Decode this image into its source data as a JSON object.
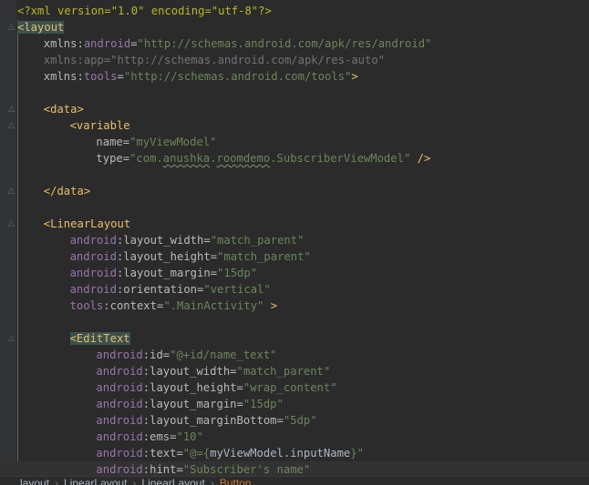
{
  "editor": {
    "language": "xml",
    "lines": [
      {
        "indent": 0,
        "fold": false,
        "current": false,
        "tokens": [
          {
            "t": "<?xml version=\"1.0\" encoding=\"utf-8\"?>",
            "c": "def"
          }
        ]
      },
      {
        "indent": 0,
        "fold": true,
        "current": false,
        "tokens": [
          {
            "t": "<",
            "c": "tag-hl"
          },
          {
            "t": "layout",
            "c": "tag-hl"
          }
        ]
      },
      {
        "indent": 4,
        "fold": false,
        "current": false,
        "tokens": [
          {
            "t": "xmlns",
            "c": "attr"
          },
          {
            "t": ":",
            "c": "attr"
          },
          {
            "t": "android",
            "c": "pre"
          },
          {
            "t": "=",
            "c": "attr"
          },
          {
            "t": "\"http://schemas.android.com/apk/res/android\"",
            "c": "str"
          }
        ]
      },
      {
        "indent": 4,
        "fold": false,
        "current": false,
        "tokens": [
          {
            "t": "xmlns:app=",
            "c": "ns-unused"
          },
          {
            "t": "\"http://schemas.android.com/apk/res-auto\"",
            "c": "ns-unused"
          }
        ]
      },
      {
        "indent": 4,
        "fold": false,
        "current": false,
        "tokens": [
          {
            "t": "xmlns",
            "c": "attr"
          },
          {
            "t": ":",
            "c": "attr"
          },
          {
            "t": "tools",
            "c": "pre"
          },
          {
            "t": "=",
            "c": "attr"
          },
          {
            "t": "\"http://schemas.android.com/tools\"",
            "c": "str"
          },
          {
            "t": ">",
            "c": "tag"
          }
        ]
      },
      {
        "indent": 0,
        "fold": false,
        "current": false,
        "tokens": []
      },
      {
        "indent": 4,
        "fold": true,
        "current": false,
        "tokens": [
          {
            "t": "<data>",
            "c": "tag"
          }
        ]
      },
      {
        "indent": 8,
        "fold": true,
        "current": false,
        "tokens": [
          {
            "t": "<variable",
            "c": "tag"
          }
        ]
      },
      {
        "indent": 12,
        "fold": false,
        "current": false,
        "tokens": [
          {
            "t": "name=",
            "c": "attr"
          },
          {
            "t": "\"myViewModel\"",
            "c": "str"
          }
        ]
      },
      {
        "indent": 12,
        "fold": false,
        "current": false,
        "tokens": [
          {
            "t": "type=",
            "c": "attr"
          },
          {
            "t": "\"com.",
            "c": "str"
          },
          {
            "t": "anushka",
            "c": "str-squig"
          },
          {
            "t": ".",
            "c": "str"
          },
          {
            "t": "roomdemo",
            "c": "str-squig"
          },
          {
            "t": ".SubscriberViewModel\"",
            "c": "str"
          },
          {
            "t": " ",
            "c": "sp"
          },
          {
            "t": "/>",
            "c": "tag"
          }
        ]
      },
      {
        "indent": 0,
        "fold": false,
        "current": false,
        "tokens": []
      },
      {
        "indent": 4,
        "fold": true,
        "current": false,
        "tokens": [
          {
            "t": "</data>",
            "c": "tag"
          }
        ]
      },
      {
        "indent": 0,
        "fold": false,
        "current": false,
        "tokens": []
      },
      {
        "indent": 4,
        "fold": true,
        "current": false,
        "tokens": [
          {
            "t": "<LinearLayout",
            "c": "tag"
          }
        ]
      },
      {
        "indent": 8,
        "fold": false,
        "current": false,
        "tokens": [
          {
            "t": "android",
            "c": "pre"
          },
          {
            "t": ":layout_width=",
            "c": "attr"
          },
          {
            "t": "\"match_parent\"",
            "c": "str"
          }
        ]
      },
      {
        "indent": 8,
        "fold": false,
        "current": false,
        "tokens": [
          {
            "t": "android",
            "c": "pre"
          },
          {
            "t": ":layout_height=",
            "c": "attr"
          },
          {
            "t": "\"match_parent\"",
            "c": "str"
          }
        ]
      },
      {
        "indent": 8,
        "fold": false,
        "current": false,
        "tokens": [
          {
            "t": "android",
            "c": "pre"
          },
          {
            "t": ":layout_margin=",
            "c": "attr"
          },
          {
            "t": "\"15dp\"",
            "c": "str"
          }
        ]
      },
      {
        "indent": 8,
        "fold": false,
        "current": false,
        "tokens": [
          {
            "t": "android",
            "c": "pre"
          },
          {
            "t": ":orientation=",
            "c": "attr"
          },
          {
            "t": "\"vertical\"",
            "c": "str"
          }
        ]
      },
      {
        "indent": 8,
        "fold": false,
        "current": false,
        "tokens": [
          {
            "t": "tools",
            "c": "pre"
          },
          {
            "t": ":context=",
            "c": "attr"
          },
          {
            "t": "\".MainActivity\"",
            "c": "str"
          },
          {
            "t": " ",
            "c": "sp"
          },
          {
            "t": ">",
            "c": "tag"
          }
        ]
      },
      {
        "indent": 0,
        "fold": false,
        "current": false,
        "tokens": []
      },
      {
        "indent": 8,
        "fold": true,
        "current": false,
        "tokens": [
          {
            "t": "<EditText",
            "c": "tag-hl"
          }
        ]
      },
      {
        "indent": 12,
        "fold": false,
        "current": false,
        "tokens": [
          {
            "t": "android",
            "c": "pre"
          },
          {
            "t": ":id=",
            "c": "attr"
          },
          {
            "t": "\"@+id/name_text\"",
            "c": "str"
          }
        ]
      },
      {
        "indent": 12,
        "fold": false,
        "current": false,
        "tokens": [
          {
            "t": "android",
            "c": "pre"
          },
          {
            "t": ":layout_width=",
            "c": "attr"
          },
          {
            "t": "\"match_parent\"",
            "c": "str"
          }
        ]
      },
      {
        "indent": 12,
        "fold": false,
        "current": false,
        "tokens": [
          {
            "t": "android",
            "c": "pre"
          },
          {
            "t": ":layout_height=",
            "c": "attr"
          },
          {
            "t": "\"wrap_content\"",
            "c": "str"
          }
        ]
      },
      {
        "indent": 12,
        "fold": false,
        "current": false,
        "tokens": [
          {
            "t": "android",
            "c": "pre"
          },
          {
            "t": ":layout_margin=",
            "c": "attr"
          },
          {
            "t": "\"15dp\"",
            "c": "str"
          }
        ]
      },
      {
        "indent": 12,
        "fold": false,
        "current": false,
        "tokens": [
          {
            "t": "android",
            "c": "pre"
          },
          {
            "t": ":layout_marginBottom=",
            "c": "attr"
          },
          {
            "t": "\"5dp\"",
            "c": "str"
          }
        ]
      },
      {
        "indent": 12,
        "fold": false,
        "current": false,
        "tokens": [
          {
            "t": "android",
            "c": "pre"
          },
          {
            "t": ":ems=",
            "c": "attr"
          },
          {
            "t": "\"10\"",
            "c": "str"
          }
        ]
      },
      {
        "indent": 12,
        "fold": false,
        "current": false,
        "tokens": [
          {
            "t": "android",
            "c": "pre"
          },
          {
            "t": ":text=",
            "c": "attr"
          },
          {
            "t": "\"@={",
            "c": "str"
          },
          {
            "t": "myViewModel.inputName",
            "c": "plain"
          },
          {
            "t": "}\"",
            "c": "str"
          }
        ]
      },
      {
        "indent": 12,
        "fold": false,
        "current": true,
        "tokens": [
          {
            "t": "android",
            "c": "pre"
          },
          {
            "t": ":hint=",
            "c": "attr"
          },
          {
            "t": "\"Subscriber's name\"",
            "c": "str"
          }
        ]
      }
    ]
  },
  "breadcrumb": {
    "items": [
      "layout",
      "LinearLayout",
      "LinearLayout",
      "Button"
    ],
    "separator": "›"
  },
  "colors": {
    "background": "#2b2b2b",
    "gutter": "#313335",
    "tag": "#e8bf6a",
    "string": "#6a8759",
    "namespace_prefix": "#9876aa",
    "attribute": "#bababa",
    "xml_declaration": "#bbb529"
  }
}
